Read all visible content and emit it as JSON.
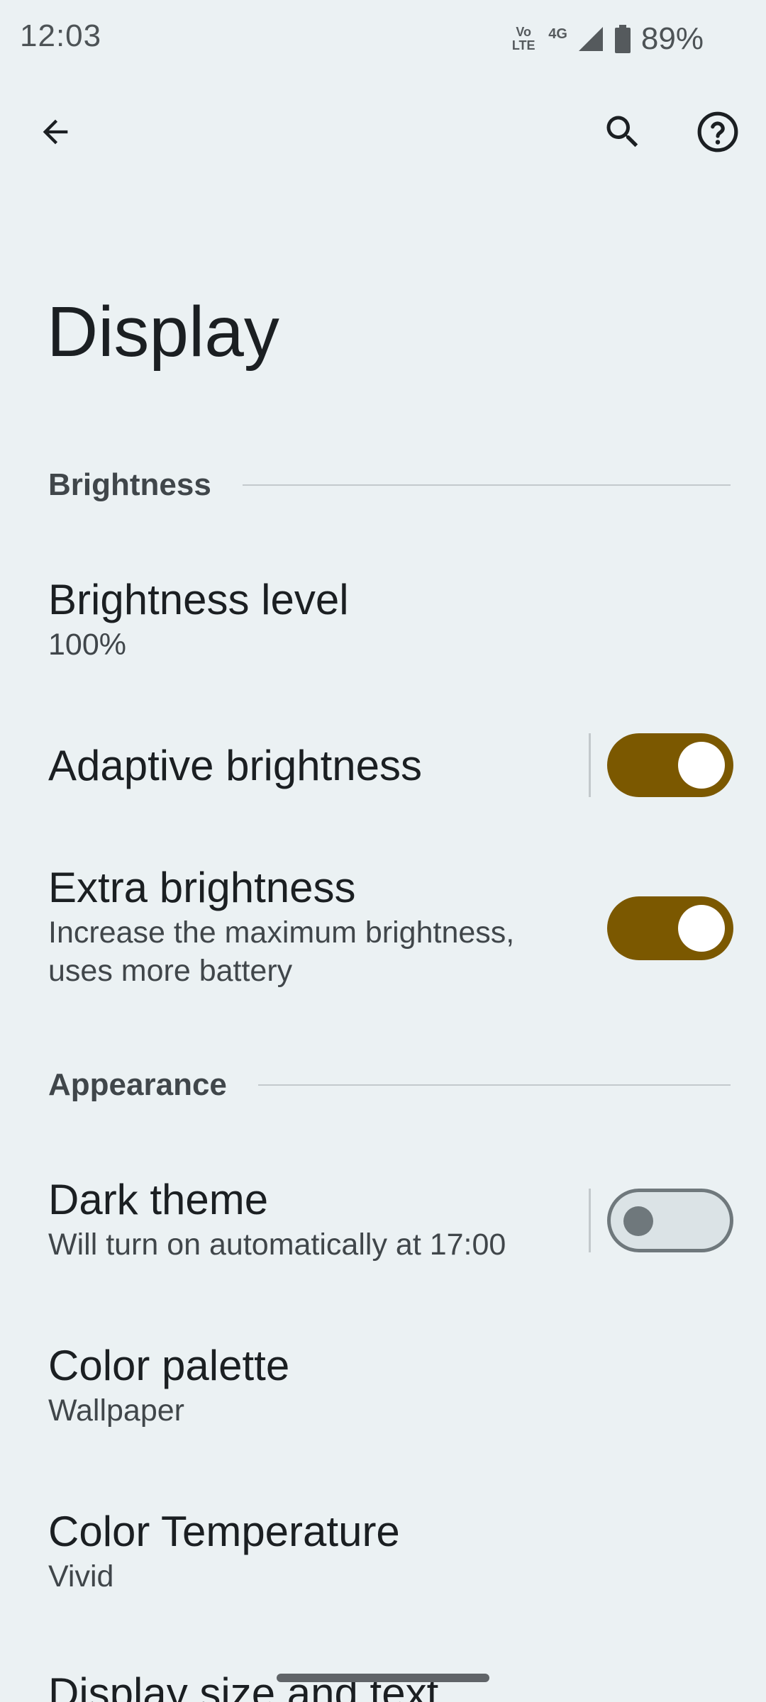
{
  "status_bar": {
    "time": "12:03",
    "volte_line1": "Vo",
    "volte_line2": "LTE",
    "network": "4G",
    "battery": "89%"
  },
  "toolbar": {
    "back_icon": "arrow-back-icon",
    "search_icon": "search-icon",
    "help_icon": "help-icon"
  },
  "page": {
    "title": "Display"
  },
  "sections": {
    "brightness": {
      "title": "Brightness",
      "level_title": "Brightness level",
      "level_value": "100%",
      "adaptive_title": "Adaptive brightness",
      "adaptive_on": true,
      "extra_title": "Extra brightness",
      "extra_summary_line1": "Increase the maximum brightness,",
      "extra_summary_line2": "uses more battery",
      "extra_on": true
    },
    "appearance": {
      "title": "Appearance",
      "dark_title": "Dark theme",
      "dark_summary": "Will turn on automatically at 17:00",
      "dark_on": false,
      "palette_title": "Color palette",
      "palette_value": "Wallpaper",
      "temp_title": "Color Temperature",
      "temp_value": "Vivid",
      "size_title": "Display size and text"
    }
  },
  "colors": {
    "background": "#ebf1f3",
    "switch_on": "#7b5800",
    "switch_off_track": "#dbe3e6",
    "switch_off_outline": "#6f787c"
  }
}
